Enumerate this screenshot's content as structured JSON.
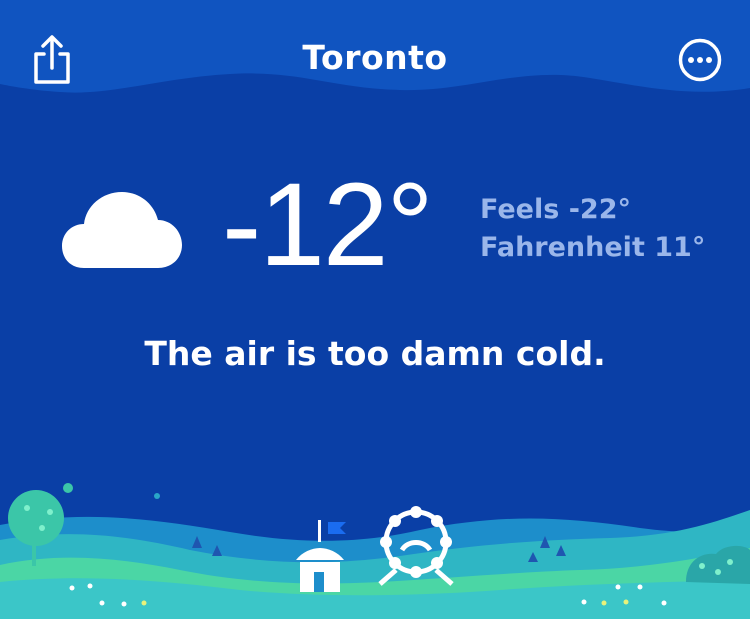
{
  "header": {
    "city": "Toronto",
    "share_icon": "share-icon",
    "more_icon": "more-options-icon"
  },
  "current": {
    "condition_icon": "cloud-icon",
    "temperature": "-12°",
    "feels_like": "Feels -22°",
    "fahrenheit": "Fahrenheit 11°",
    "message": "The air is too damn cold."
  },
  "colors": {
    "background": "#0a3fa6",
    "top_band": "#1054c0",
    "secondary_text": "#9ab6ea",
    "hill_teal": "#3bc6c8",
    "hill_green": "#4bd6a5",
    "flag_blue": "#1a6cf0"
  }
}
